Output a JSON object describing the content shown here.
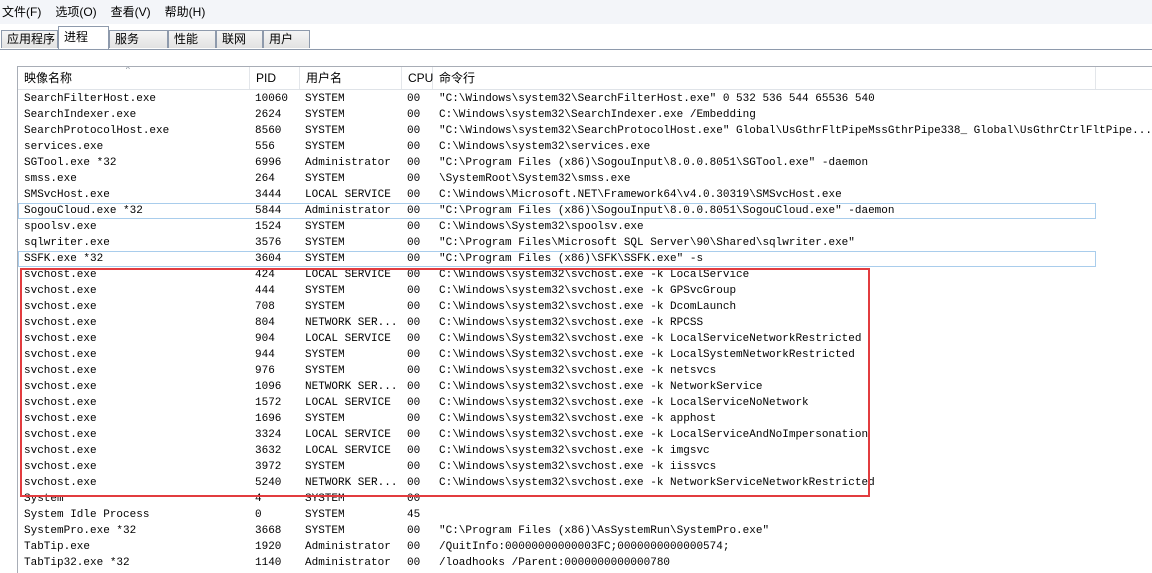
{
  "menu": [
    "文件(F)",
    "选项(O)",
    "查看(V)",
    "帮助(H)"
  ],
  "tabs": [
    "应用程序",
    "进程",
    "服务",
    "性能",
    "联网",
    "用户"
  ],
  "active_tab": "进程",
  "columns": {
    "name": "映像名称",
    "pid": "PID",
    "user": "用户名",
    "cpu": "CPU",
    "cmd": "命令行"
  },
  "sort_indicator": "^",
  "highlight_color": "#e23c3f",
  "selection_color": "#a9cdec",
  "rows": [
    {
      "name": "SearchFilterHost.exe",
      "pid": "10060",
      "user": "SYSTEM",
      "cpu": "00",
      "cmd": "\"C:\\Windows\\system32\\SearchFilterHost.exe\" 0 532 536 544 65536 540"
    },
    {
      "name": "SearchIndexer.exe",
      "pid": "2624",
      "user": "SYSTEM",
      "cpu": "00",
      "cmd": "C:\\Windows\\system32\\SearchIndexer.exe /Embedding"
    },
    {
      "name": "SearchProtocolHost.exe",
      "pid": "8560",
      "user": "SYSTEM",
      "cpu": "00",
      "cmd": "\"C:\\Windows\\system32\\SearchProtocolHost.exe\" Global\\UsGthrFltPipeMssGthrPipe338_ Global\\UsGthrCtrlFltPipe..."
    },
    {
      "name": "services.exe",
      "pid": "556",
      "user": "SYSTEM",
      "cpu": "00",
      "cmd": "C:\\Windows\\system32\\services.exe"
    },
    {
      "name": "SGTool.exe *32",
      "pid": "6996",
      "user": "Administrator",
      "cpu": "00",
      "cmd": "\"C:\\Program Files (x86)\\SogouInput\\8.0.0.8051\\SGTool.exe\" -daemon"
    },
    {
      "name": "smss.exe",
      "pid": "264",
      "user": "SYSTEM",
      "cpu": "00",
      "cmd": "\\SystemRoot\\System32\\smss.exe"
    },
    {
      "name": "SMSvcHost.exe",
      "pid": "3444",
      "user": "LOCAL SERVICE",
      "cpu": "00",
      "cmd": "C:\\Windows\\Microsoft.NET\\Framework64\\v4.0.30319\\SMSvcHost.exe"
    },
    {
      "name": "SogouCloud.exe *32",
      "pid": "5844",
      "user": "Administrator",
      "cpu": "00",
      "cmd": "\"C:\\Program Files (x86)\\SogouInput\\8.0.0.8051\\SogouCloud.exe\" -daemon",
      "sel": true
    },
    {
      "name": "spoolsv.exe",
      "pid": "1524",
      "user": "SYSTEM",
      "cpu": "00",
      "cmd": "C:\\Windows\\System32\\spoolsv.exe"
    },
    {
      "name": "sqlwriter.exe",
      "pid": "3576",
      "user": "SYSTEM",
      "cpu": "00",
      "cmd": "\"C:\\Program Files\\Microsoft SQL Server\\90\\Shared\\sqlwriter.exe\""
    },
    {
      "name": "SSFK.exe *32",
      "pid": "3604",
      "user": "SYSTEM",
      "cpu": "00",
      "cmd": "\"C:\\Program Files (x86)\\SFK\\SSFK.exe\" -s",
      "sel": true
    },
    {
      "name": "svchost.exe",
      "pid": "424",
      "user": "LOCAL SERVICE",
      "cpu": "00",
      "cmd": "C:\\Windows\\system32\\svchost.exe -k LocalService"
    },
    {
      "name": "svchost.exe",
      "pid": "444",
      "user": "SYSTEM",
      "cpu": "00",
      "cmd": "C:\\Windows\\system32\\svchost.exe -k GPSvcGroup"
    },
    {
      "name": "svchost.exe",
      "pid": "708",
      "user": "SYSTEM",
      "cpu": "00",
      "cmd": "C:\\Windows\\system32\\svchost.exe -k DcomLaunch"
    },
    {
      "name": "svchost.exe",
      "pid": "804",
      "user": "NETWORK SER...",
      "cpu": "00",
      "cmd": "C:\\Windows\\system32\\svchost.exe -k RPCSS"
    },
    {
      "name": "svchost.exe",
      "pid": "904",
      "user": "LOCAL SERVICE",
      "cpu": "00",
      "cmd": "C:\\Windows\\System32\\svchost.exe -k LocalServiceNetworkRestricted"
    },
    {
      "name": "svchost.exe",
      "pid": "944",
      "user": "SYSTEM",
      "cpu": "00",
      "cmd": "C:\\Windows\\System32\\svchost.exe -k LocalSystemNetworkRestricted"
    },
    {
      "name": "svchost.exe",
      "pid": "976",
      "user": "SYSTEM",
      "cpu": "00",
      "cmd": "C:\\Windows\\system32\\svchost.exe -k netsvcs"
    },
    {
      "name": "svchost.exe",
      "pid": "1096",
      "user": "NETWORK SER...",
      "cpu": "00",
      "cmd": "C:\\Windows\\system32\\svchost.exe -k NetworkService"
    },
    {
      "name": "svchost.exe",
      "pid": "1572",
      "user": "LOCAL SERVICE",
      "cpu": "00",
      "cmd": "C:\\Windows\\system32\\svchost.exe -k LocalServiceNoNetwork"
    },
    {
      "name": "svchost.exe",
      "pid": "1696",
      "user": "SYSTEM",
      "cpu": "00",
      "cmd": "C:\\Windows\\system32\\svchost.exe -k apphost"
    },
    {
      "name": "svchost.exe",
      "pid": "3324",
      "user": "LOCAL SERVICE",
      "cpu": "00",
      "cmd": "C:\\Windows\\system32\\svchost.exe -k LocalServiceAndNoImpersonation"
    },
    {
      "name": "svchost.exe",
      "pid": "3632",
      "user": "LOCAL SERVICE",
      "cpu": "00",
      "cmd": "C:\\Windows\\system32\\svchost.exe -k imgsvc"
    },
    {
      "name": "svchost.exe",
      "pid": "3972",
      "user": "SYSTEM",
      "cpu": "00",
      "cmd": "C:\\Windows\\system32\\svchost.exe -k iissvcs"
    },
    {
      "name": "svchost.exe",
      "pid": "5240",
      "user": "NETWORK SER...",
      "cpu": "00",
      "cmd": "C:\\Windows\\system32\\svchost.exe -k NetworkServiceNetworkRestricted"
    },
    {
      "name": "System",
      "pid": "4",
      "user": "SYSTEM",
      "cpu": "00",
      "cmd": ""
    },
    {
      "name": "System Idle Process",
      "pid": "0",
      "user": "SYSTEM",
      "cpu": "45",
      "cmd": ""
    },
    {
      "name": "SystemPro.exe *32",
      "pid": "3668",
      "user": "SYSTEM",
      "cpu": "00",
      "cmd": "\"C:\\Program Files (x86)\\AsSystemRun\\SystemPro.exe\""
    },
    {
      "name": "TabTip.exe",
      "pid": "1920",
      "user": "Administrator",
      "cpu": "00",
      "cmd": "/QuitInfo:00000000000003FC;0000000000000574;"
    },
    {
      "name": "TabTip32.exe *32",
      "pid": "1140",
      "user": "Administrator",
      "cpu": "00",
      "cmd": "/loadhooks /Parent:0000000000000780"
    }
  ]
}
